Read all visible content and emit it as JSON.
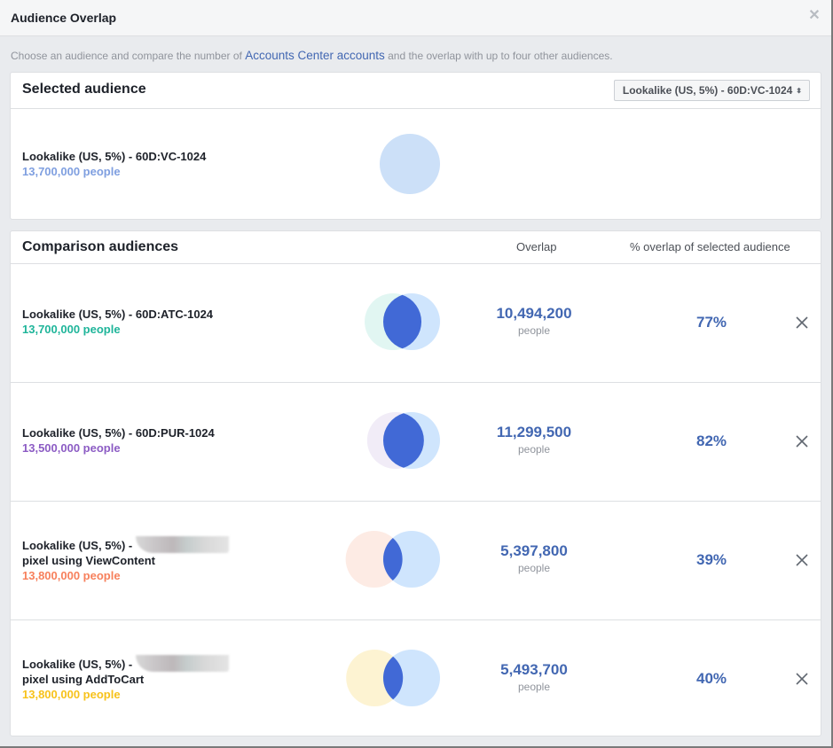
{
  "dialog": {
    "title": "Audience Overlap",
    "close_icon": "close-icon",
    "description_prefix": "Choose an audience and compare the number of ",
    "description_link": "Accounts Center accounts",
    "description_suffix": " and the overlap with up to four other audiences."
  },
  "selected": {
    "heading": "Selected audience",
    "dropdown_value": "Lookalike (US, 5%) - 60D:VC-1024",
    "dropdown_icon": "sort-arrows-icon",
    "name": "Lookalike (US, 5%) - 60D:VC-1024",
    "count": "13,700,000 people",
    "count_color": "#7f9fe0",
    "circle_color": "#cce0f8"
  },
  "comparison": {
    "heading": "Comparison audiences",
    "col_overlap": "Overlap",
    "col_percent": "% overlap of selected audience",
    "intersection_color": "#4169d6",
    "selected_circle_color": "#cce4fd",
    "rows": [
      {
        "name_line1": "Lookalike (US, 5%) - 60D:ATC-1024",
        "name_line2": "",
        "redacted": false,
        "count": "13,700,000 people",
        "color": "#1fb59a",
        "circle_color": "#e1f6f2",
        "overlap": "10,494,200",
        "overlap_unit": "people",
        "percent": "77%",
        "percent_value": 77
      },
      {
        "name_line1": "Lookalike (US, 5%) - 60D:PUR-1024",
        "name_line2": "",
        "redacted": false,
        "count": "13,500,000 people",
        "color": "#8c5cc4",
        "circle_color": "#f1ecf7",
        "overlap": "11,299,500",
        "overlap_unit": "people",
        "percent": "82%",
        "percent_value": 82
      },
      {
        "name_line1": "Lookalike (US, 5%) -",
        "name_line2": "pixel using ViewContent",
        "redacted": true,
        "count": "13,800,000 people",
        "color": "#f7805c",
        "circle_color": "#fdebe4",
        "overlap": "5,397,800",
        "overlap_unit": "people",
        "percent": "39%",
        "percent_value": 39
      },
      {
        "name_line1": "Lookalike (US, 5%) -",
        "name_line2": "pixel using AddToCart",
        "redacted": true,
        "count": "13,800,000 people",
        "color": "#f7c21b",
        "circle_color": "#fdf3d2",
        "overlap": "5,493,700",
        "overlap_unit": "people",
        "percent": "40%",
        "percent_value": 40
      }
    ]
  }
}
